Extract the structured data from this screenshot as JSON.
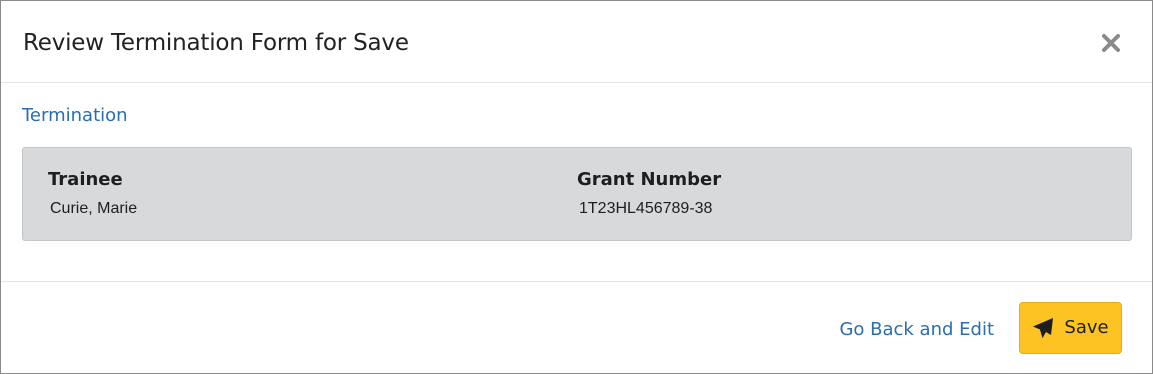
{
  "modal": {
    "title": "Review Termination Form for Save",
    "close_icon": "close-icon"
  },
  "body": {
    "section_title": "Termination",
    "fields": [
      {
        "label": "Trainee",
        "value": "Curie, Marie"
      },
      {
        "label": "Grant Number",
        "value": "1T23HL456789-38"
      }
    ]
  },
  "footer": {
    "go_back_label": "Go Back and Edit",
    "save_label": "Save",
    "save_icon": "paper-plane-icon"
  },
  "colors": {
    "link": "#2a6db0",
    "panel_bg": "#d8d9db",
    "save_button": "#fdc322"
  }
}
